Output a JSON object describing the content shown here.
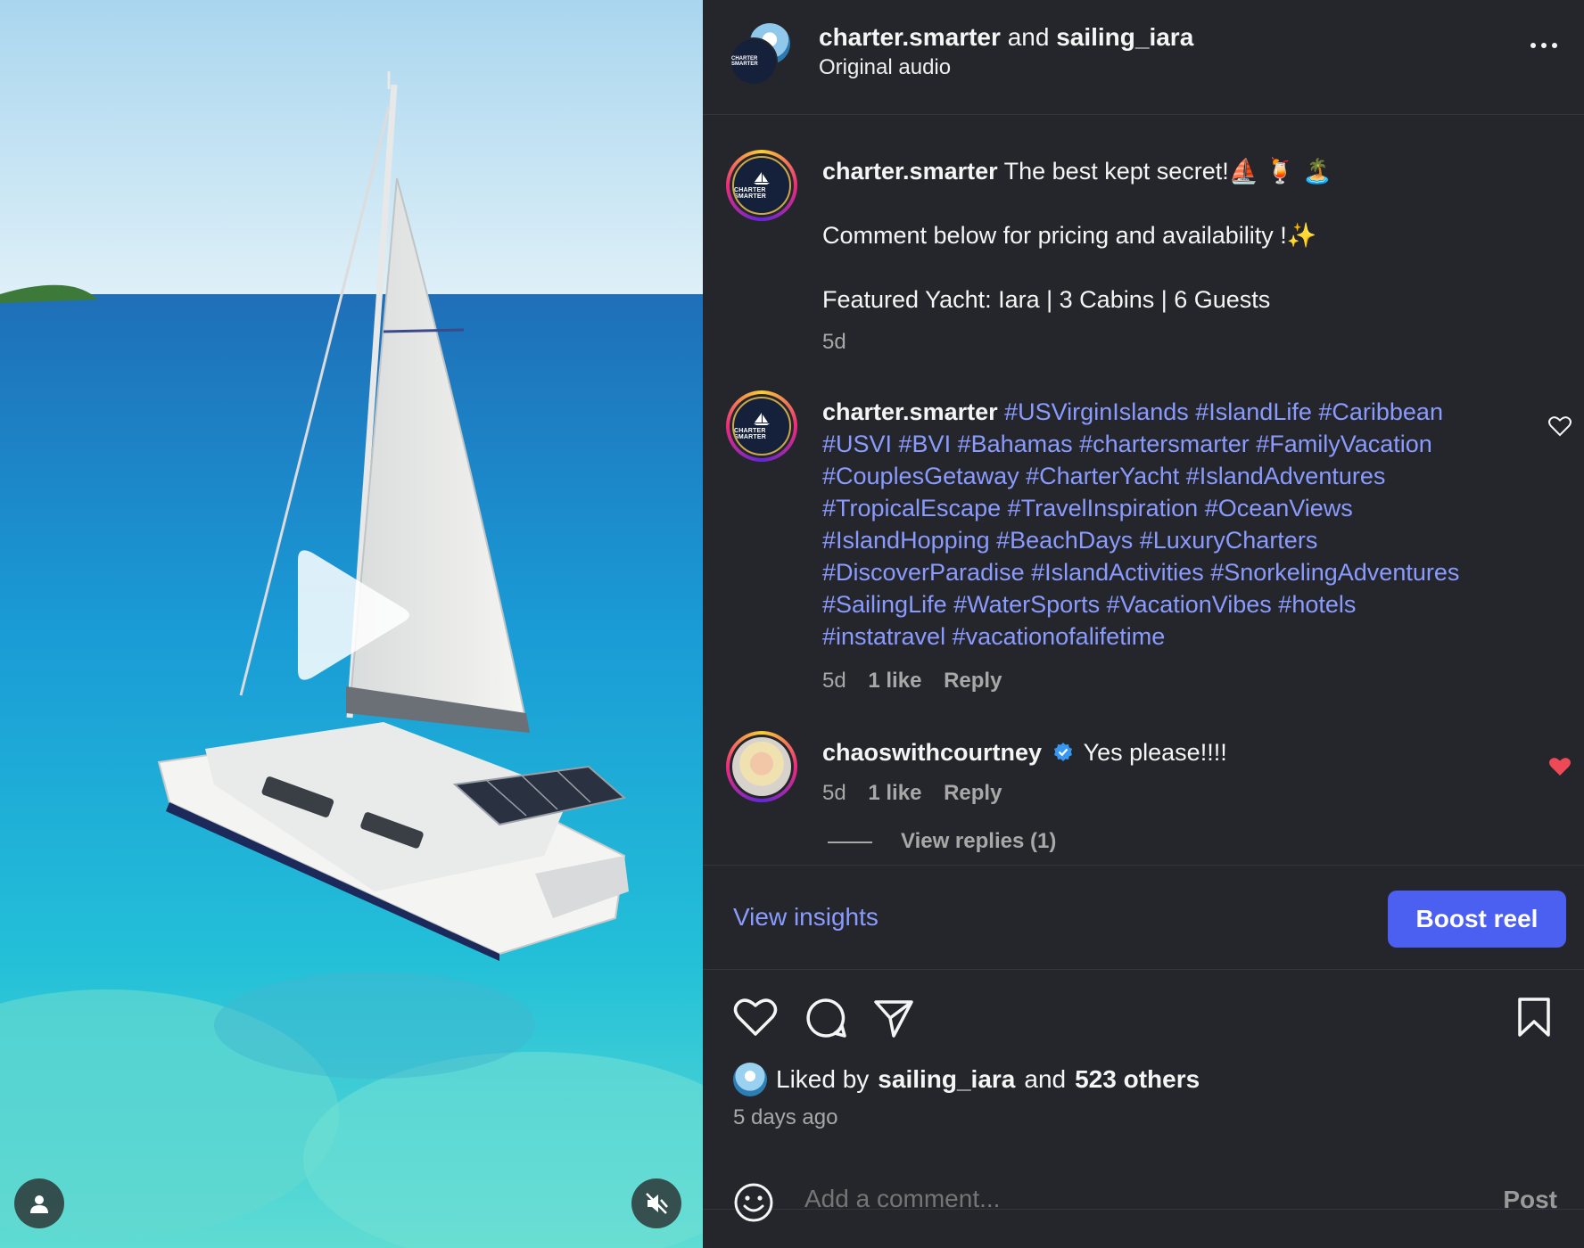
{
  "header": {
    "author1": "charter.smarter",
    "and": "and",
    "author2": "sailing_iara",
    "audio": "Original audio"
  },
  "logo_text": "CHARTER SMARTER",
  "caption": {
    "user": "charter.smarter",
    "line1": "The best kept secret!⛵ 🍹 🏝️",
    "line2": "Comment below for pricing and availability !✨",
    "line3": "Featured Yacht: Iara | 3 Cabins | 6 Guests",
    "time": "5d"
  },
  "comment_hashtags": {
    "user": "charter.smarter",
    "lines": [
      "#USVirginIslands #IslandLife #Caribbean",
      "#USVI #BVI #Bahamas #chartersmarter #FamilyVacation",
      "#CouplesGetaway #CharterYacht #IslandAdventures",
      "#TropicalEscape #TravelInspiration #OceanViews",
      "#IslandHopping #BeachDays #LuxuryCharters",
      "#DiscoverParadise #IslandActivities #SnorkelingAdventures",
      "#SailingLife #WaterSports #VacationVibes #hotels",
      "#instatravel #vacationofalifetime"
    ],
    "time": "5d",
    "likes": "1 like",
    "reply": "Reply"
  },
  "comment_reply": {
    "user": "chaoswithcourtney",
    "text": "Yes please!!!!",
    "time": "5d",
    "likes": "1 like",
    "reply": "Reply",
    "view_replies": "View replies (1)"
  },
  "insights": {
    "view_label": "View insights",
    "boost_label": "Boost reel"
  },
  "likes_line": {
    "prefix": "Liked by",
    "user": "sailing_iara",
    "and": "and",
    "others": "523 others"
  },
  "posted": "5 days ago",
  "comment_box": {
    "placeholder": "Add a comment...",
    "post_label": "Post"
  },
  "colors": {
    "accent": "#4b5ff0",
    "hashtag": "#8a9bff",
    "liked_heart": "#ed4956"
  }
}
